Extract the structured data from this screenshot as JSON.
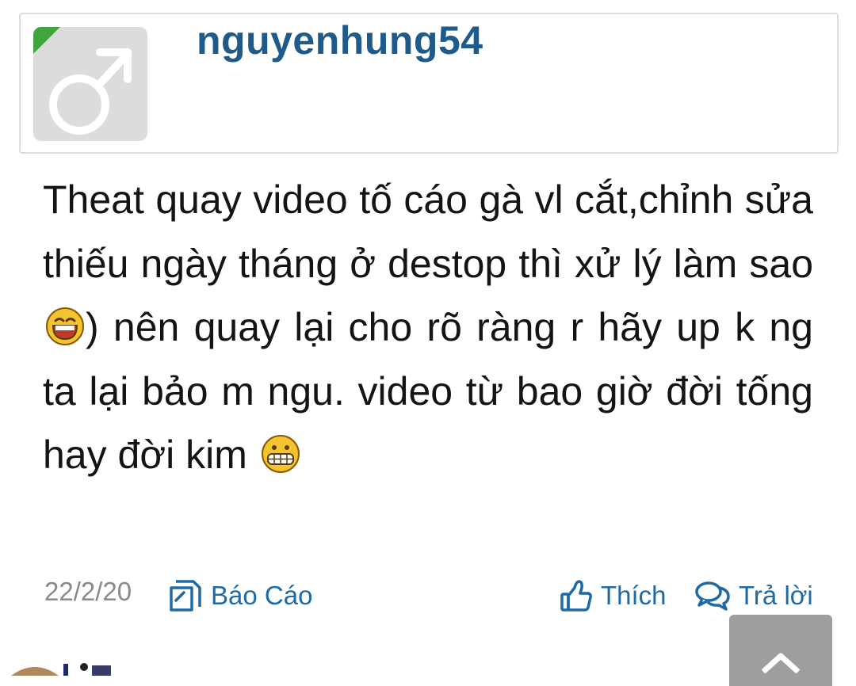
{
  "post": {
    "author": "nguyenhung54",
    "message_lines": [
      "Theat quay video tố cáo gà vl",
      "cắt,chỉnh sửa thiếu ngày tháng ở",
      "destop thì xử lý làm sao",
      ") nên quay",
      "lại cho rõ ràng r hãy up k ng ta lại bảo",
      "m ngu. video từ bao giờ đời tống hay",
      "đời kim"
    ],
    "date": "22/2/20"
  },
  "actions": {
    "report_label": "Báo Cáo",
    "like_label": "Thích",
    "reply_label": "Trả lời"
  },
  "icons": {
    "avatar": "male-symbol-icon",
    "report": "report-flag-icon",
    "like": "thumbs-up-icon",
    "reply": "speech-bubbles-icon",
    "scroll_top": "chevron-up-icon",
    "emoji_laugh": "laughing-emoji-icon",
    "emoji_grin": "grinning-emoji-icon"
  },
  "colors": {
    "username": "#1e5a8a",
    "action_text": "#1e6aa6",
    "date_text": "#8a8a8a",
    "avatar_bg": "#dcdcdc",
    "online_indicator": "#3fa53f",
    "scroll_button": "#9e9e9e"
  }
}
